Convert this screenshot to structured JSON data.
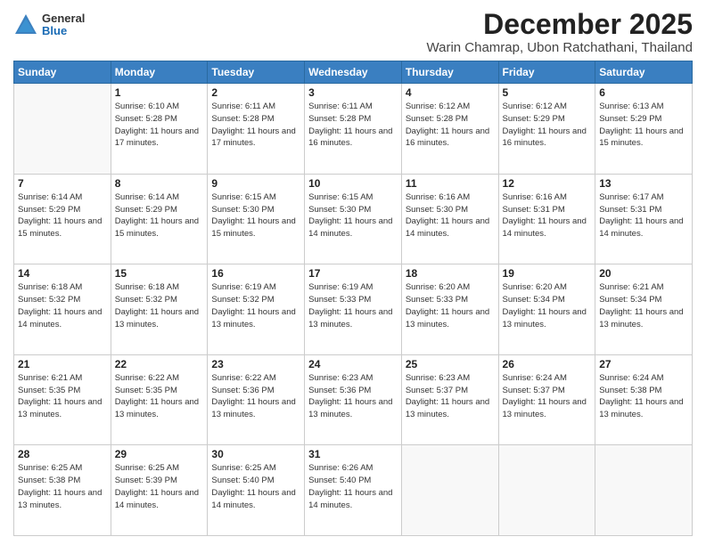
{
  "header": {
    "logo_general": "General",
    "logo_blue": "Blue",
    "month_title": "December 2025",
    "location": "Warin Chamrap, Ubon Ratchathani, Thailand"
  },
  "calendar": {
    "days_of_week": [
      "Sunday",
      "Monday",
      "Tuesday",
      "Wednesday",
      "Thursday",
      "Friday",
      "Saturday"
    ],
    "weeks": [
      [
        {
          "day": "",
          "sunrise": "",
          "sunset": "",
          "daylight": ""
        },
        {
          "day": "1",
          "sunrise": "Sunrise: 6:10 AM",
          "sunset": "Sunset: 5:28 PM",
          "daylight": "Daylight: 11 hours and 17 minutes."
        },
        {
          "day": "2",
          "sunrise": "Sunrise: 6:11 AM",
          "sunset": "Sunset: 5:28 PM",
          "daylight": "Daylight: 11 hours and 17 minutes."
        },
        {
          "day": "3",
          "sunrise": "Sunrise: 6:11 AM",
          "sunset": "Sunset: 5:28 PM",
          "daylight": "Daylight: 11 hours and 16 minutes."
        },
        {
          "day": "4",
          "sunrise": "Sunrise: 6:12 AM",
          "sunset": "Sunset: 5:28 PM",
          "daylight": "Daylight: 11 hours and 16 minutes."
        },
        {
          "day": "5",
          "sunrise": "Sunrise: 6:12 AM",
          "sunset": "Sunset: 5:29 PM",
          "daylight": "Daylight: 11 hours and 16 minutes."
        },
        {
          "day": "6",
          "sunrise": "Sunrise: 6:13 AM",
          "sunset": "Sunset: 5:29 PM",
          "daylight": "Daylight: 11 hours and 15 minutes."
        }
      ],
      [
        {
          "day": "7",
          "sunrise": "Sunrise: 6:14 AM",
          "sunset": "Sunset: 5:29 PM",
          "daylight": "Daylight: 11 hours and 15 minutes."
        },
        {
          "day": "8",
          "sunrise": "Sunrise: 6:14 AM",
          "sunset": "Sunset: 5:29 PM",
          "daylight": "Daylight: 11 hours and 15 minutes."
        },
        {
          "day": "9",
          "sunrise": "Sunrise: 6:15 AM",
          "sunset": "Sunset: 5:30 PM",
          "daylight": "Daylight: 11 hours and 15 minutes."
        },
        {
          "day": "10",
          "sunrise": "Sunrise: 6:15 AM",
          "sunset": "Sunset: 5:30 PM",
          "daylight": "Daylight: 11 hours and 14 minutes."
        },
        {
          "day": "11",
          "sunrise": "Sunrise: 6:16 AM",
          "sunset": "Sunset: 5:30 PM",
          "daylight": "Daylight: 11 hours and 14 minutes."
        },
        {
          "day": "12",
          "sunrise": "Sunrise: 6:16 AM",
          "sunset": "Sunset: 5:31 PM",
          "daylight": "Daylight: 11 hours and 14 minutes."
        },
        {
          "day": "13",
          "sunrise": "Sunrise: 6:17 AM",
          "sunset": "Sunset: 5:31 PM",
          "daylight": "Daylight: 11 hours and 14 minutes."
        }
      ],
      [
        {
          "day": "14",
          "sunrise": "Sunrise: 6:18 AM",
          "sunset": "Sunset: 5:32 PM",
          "daylight": "Daylight: 11 hours and 14 minutes."
        },
        {
          "day": "15",
          "sunrise": "Sunrise: 6:18 AM",
          "sunset": "Sunset: 5:32 PM",
          "daylight": "Daylight: 11 hours and 13 minutes."
        },
        {
          "day": "16",
          "sunrise": "Sunrise: 6:19 AM",
          "sunset": "Sunset: 5:32 PM",
          "daylight": "Daylight: 11 hours and 13 minutes."
        },
        {
          "day": "17",
          "sunrise": "Sunrise: 6:19 AM",
          "sunset": "Sunset: 5:33 PM",
          "daylight": "Daylight: 11 hours and 13 minutes."
        },
        {
          "day": "18",
          "sunrise": "Sunrise: 6:20 AM",
          "sunset": "Sunset: 5:33 PM",
          "daylight": "Daylight: 11 hours and 13 minutes."
        },
        {
          "day": "19",
          "sunrise": "Sunrise: 6:20 AM",
          "sunset": "Sunset: 5:34 PM",
          "daylight": "Daylight: 11 hours and 13 minutes."
        },
        {
          "day": "20",
          "sunrise": "Sunrise: 6:21 AM",
          "sunset": "Sunset: 5:34 PM",
          "daylight": "Daylight: 11 hours and 13 minutes."
        }
      ],
      [
        {
          "day": "21",
          "sunrise": "Sunrise: 6:21 AM",
          "sunset": "Sunset: 5:35 PM",
          "daylight": "Daylight: 11 hours and 13 minutes."
        },
        {
          "day": "22",
          "sunrise": "Sunrise: 6:22 AM",
          "sunset": "Sunset: 5:35 PM",
          "daylight": "Daylight: 11 hours and 13 minutes."
        },
        {
          "day": "23",
          "sunrise": "Sunrise: 6:22 AM",
          "sunset": "Sunset: 5:36 PM",
          "daylight": "Daylight: 11 hours and 13 minutes."
        },
        {
          "day": "24",
          "sunrise": "Sunrise: 6:23 AM",
          "sunset": "Sunset: 5:36 PM",
          "daylight": "Daylight: 11 hours and 13 minutes."
        },
        {
          "day": "25",
          "sunrise": "Sunrise: 6:23 AM",
          "sunset": "Sunset: 5:37 PM",
          "daylight": "Daylight: 11 hours and 13 minutes."
        },
        {
          "day": "26",
          "sunrise": "Sunrise: 6:24 AM",
          "sunset": "Sunset: 5:37 PM",
          "daylight": "Daylight: 11 hours and 13 minutes."
        },
        {
          "day": "27",
          "sunrise": "Sunrise: 6:24 AM",
          "sunset": "Sunset: 5:38 PM",
          "daylight": "Daylight: 11 hours and 13 minutes."
        }
      ],
      [
        {
          "day": "28",
          "sunrise": "Sunrise: 6:25 AM",
          "sunset": "Sunset: 5:38 PM",
          "daylight": "Daylight: 11 hours and 13 minutes."
        },
        {
          "day": "29",
          "sunrise": "Sunrise: 6:25 AM",
          "sunset": "Sunset: 5:39 PM",
          "daylight": "Daylight: 11 hours and 14 minutes."
        },
        {
          "day": "30",
          "sunrise": "Sunrise: 6:25 AM",
          "sunset": "Sunset: 5:40 PM",
          "daylight": "Daylight: 11 hours and 14 minutes."
        },
        {
          "day": "31",
          "sunrise": "Sunrise: 6:26 AM",
          "sunset": "Sunset: 5:40 PM",
          "daylight": "Daylight: 11 hours and 14 minutes."
        },
        {
          "day": "",
          "sunrise": "",
          "sunset": "",
          "daylight": ""
        },
        {
          "day": "",
          "sunrise": "",
          "sunset": "",
          "daylight": ""
        },
        {
          "day": "",
          "sunrise": "",
          "sunset": "",
          "daylight": ""
        }
      ]
    ]
  }
}
